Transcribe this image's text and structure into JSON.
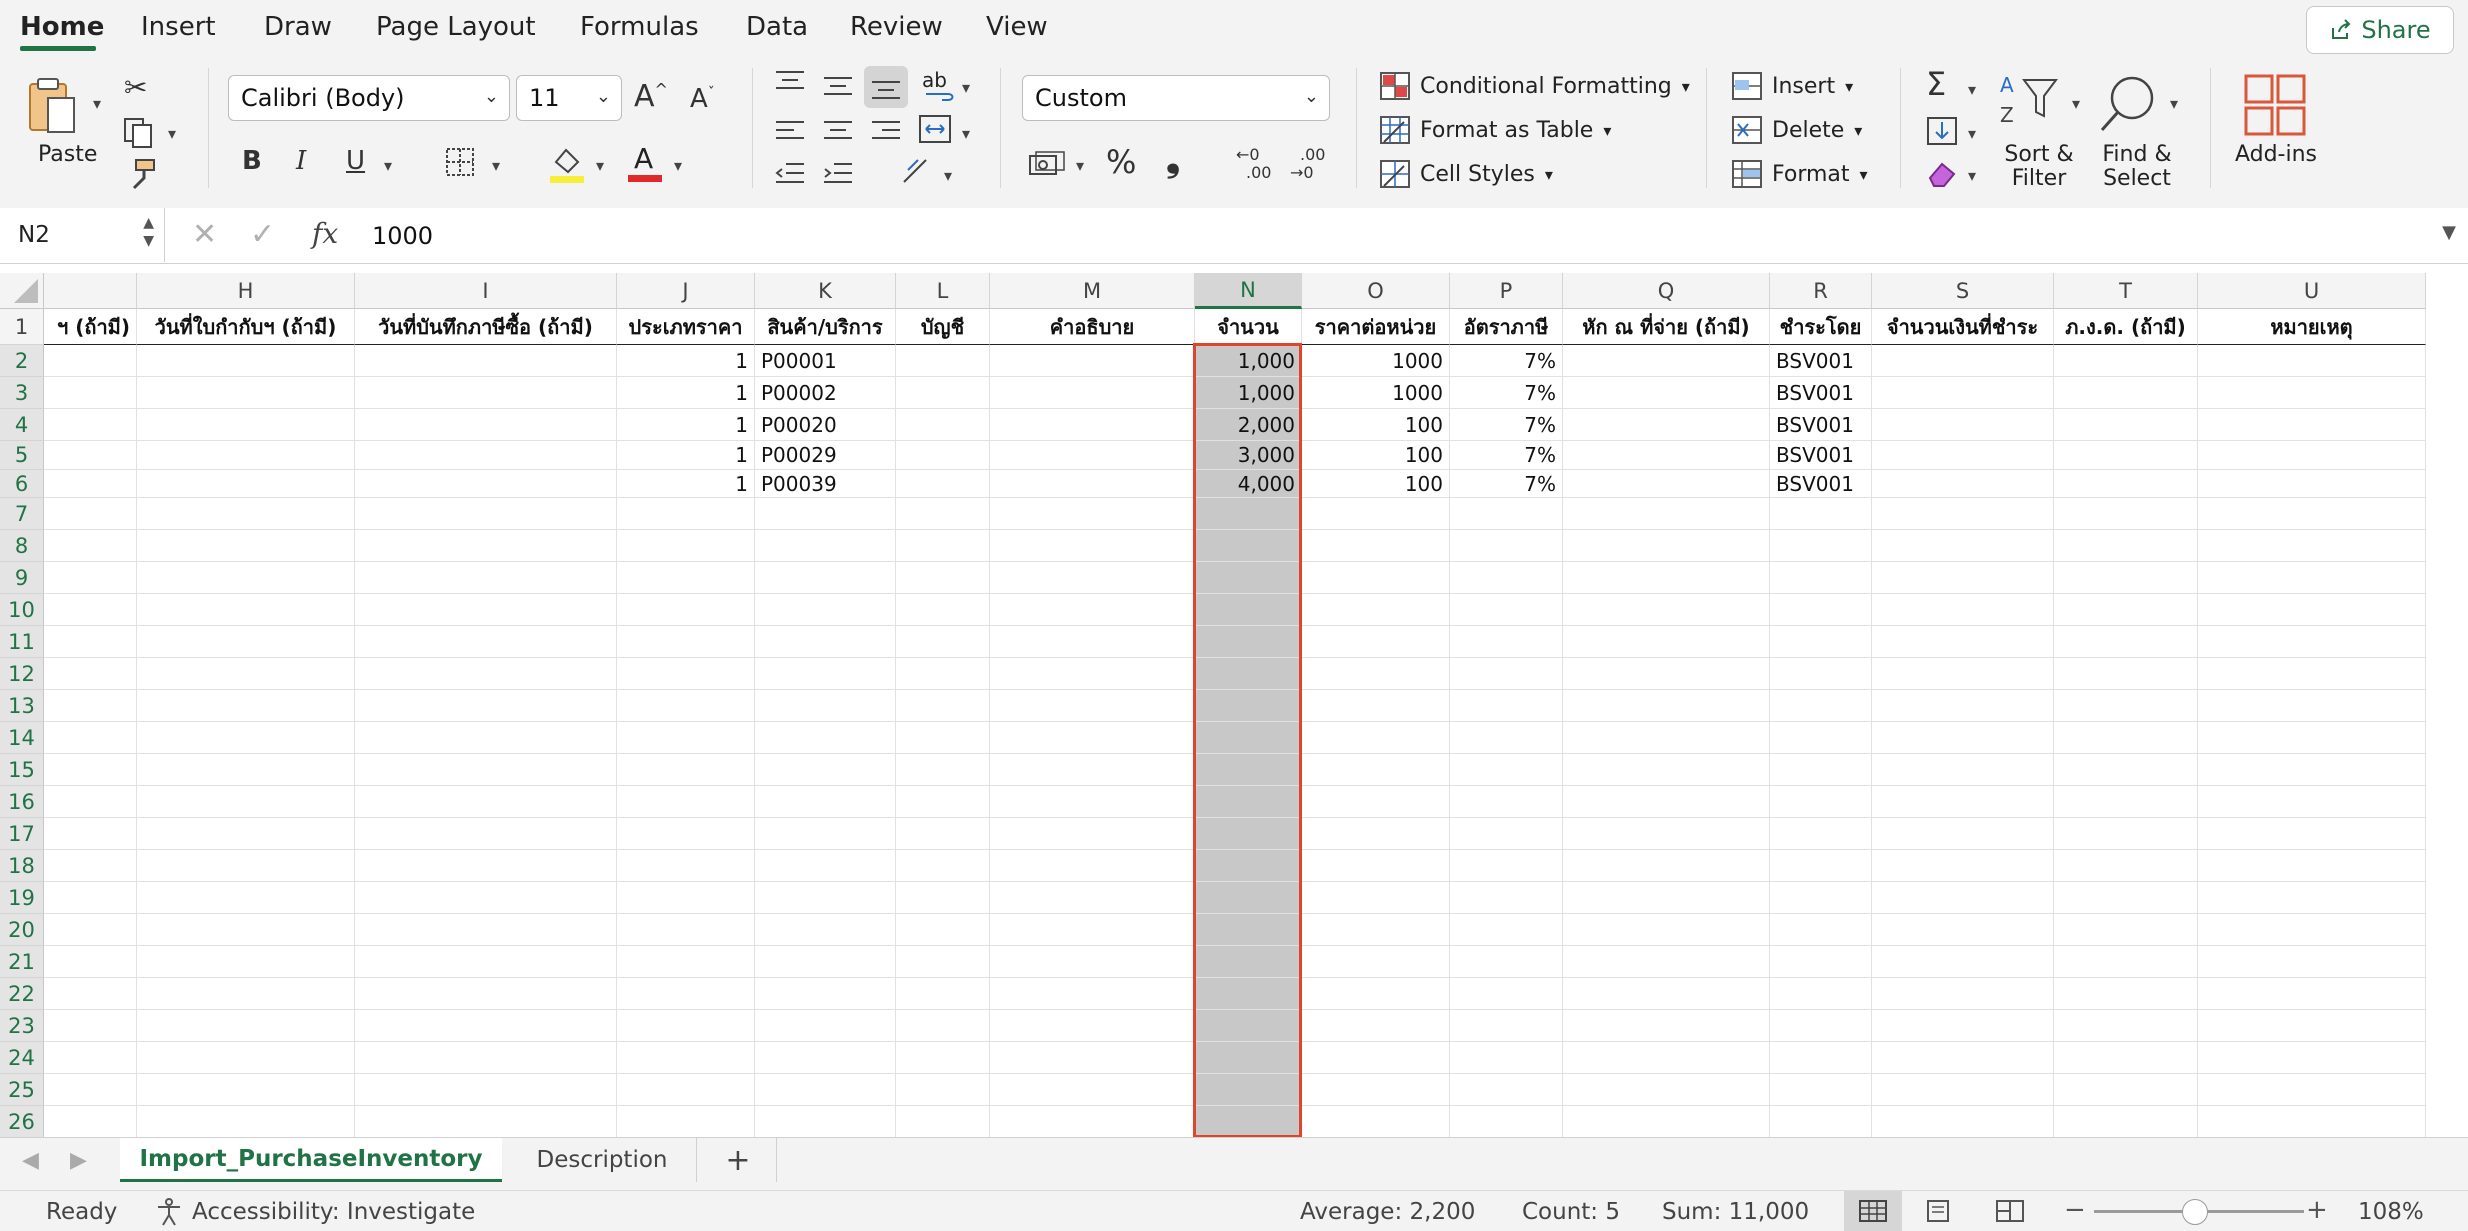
{
  "ribbon": {
    "tabs": [
      "Home",
      "Insert",
      "Draw",
      "Page Layout",
      "Formulas",
      "Data",
      "Review",
      "View"
    ],
    "share_label": "Share",
    "paste_label": "Paste",
    "font_name": "Calibri (Body)",
    "font_size": "11",
    "number_format": "Custom",
    "conditional_formatting": "Conditional Formatting",
    "format_as_table": "Format as Table",
    "cell_styles": "Cell Styles",
    "insert": "Insert",
    "delete": "Delete",
    "format": "Format",
    "sort_filter_1": "Sort &",
    "sort_filter_2": "Filter",
    "find_select_1": "Find &",
    "find_select_2": "Select",
    "addins": "Add-ins",
    "bold": "B",
    "italic": "I",
    "underline": "U",
    "font_color_letter": "A",
    "increase_font": "A",
    "decrease_font": "A",
    "percent": "%",
    "comma": "❟",
    "inc_decimal_1": "←0",
    "inc_decimal_2": ".00",
    "dec_decimal_1": ".00",
    "dec_decimal_2": "→0",
    "wrap_text": "ab"
  },
  "formula_bar": {
    "name_box": "N2",
    "fx_label": "fx",
    "value": "1000"
  },
  "grid": {
    "columns": [
      {
        "letter": "",
        "header": "ฯ (ถ้ามี)"
      },
      {
        "letter": "H",
        "header": "วันที่ใบกำกับฯ (ถ้ามี)"
      },
      {
        "letter": "I",
        "header": "วันที่บันทึกภาษีซื้อ (ถ้ามี)"
      },
      {
        "letter": "J",
        "header": "ประเภทราคา"
      },
      {
        "letter": "K",
        "header": "สินค้า/บริการ"
      },
      {
        "letter": "L",
        "header": "บัญชี"
      },
      {
        "letter": "M",
        "header": "คำอธิบาย"
      },
      {
        "letter": "N",
        "header": "จำนวน"
      },
      {
        "letter": "O",
        "header": "ราคาต่อหน่วย"
      },
      {
        "letter": "P",
        "header": "อัตราภาษี"
      },
      {
        "letter": "Q",
        "header": "หัก ณ ที่จ่าย (ถ้ามี)"
      },
      {
        "letter": "R",
        "header": "ชำระโดย"
      },
      {
        "letter": "S",
        "header": "จำนวนเงินที่ชำระ"
      },
      {
        "letter": "T",
        "header": "ภ.ง.ด. (ถ้ามี)"
      },
      {
        "letter": "U",
        "header": "หมายเหตุ"
      }
    ],
    "rows": [
      {
        "num": "2",
        "J": "1",
        "K": "P00001",
        "N": "1,000",
        "O": "1000",
        "P": "7%",
        "R": "BSV001"
      },
      {
        "num": "3",
        "J": "1",
        "K": "P00002",
        "N": "1,000",
        "O": "1000",
        "P": "7%",
        "R": "BSV001"
      },
      {
        "num": "4",
        "J": "1",
        "K": "P00020",
        "N": "2,000",
        "O": "100",
        "P": "7%",
        "R": "BSV001"
      },
      {
        "num": "5",
        "J": "1",
        "K": "P00029",
        "N": "3,000",
        "O": "100",
        "P": "7%",
        "R": "BSV001"
      },
      {
        "num": "6",
        "J": "1",
        "K": "P00039",
        "N": "4,000",
        "O": "100",
        "P": "7%",
        "R": "BSV001"
      }
    ],
    "row_numbers": [
      "1",
      "2",
      "3",
      "4",
      "5",
      "6",
      "7",
      "8",
      "9",
      "10",
      "11",
      "12",
      "13",
      "14",
      "15",
      "16",
      "17",
      "18",
      "19",
      "20",
      "21",
      "22",
      "23",
      "24",
      "25",
      "26"
    ],
    "selected_column": "N",
    "accent_color": "#217346",
    "selection_border_color": "#e0452b",
    "selection_fill_color": "#c8c8c8"
  },
  "sheet_tabs": {
    "active": "Import_PurchaseInventory",
    "other": "Description",
    "add": "+"
  },
  "status_bar": {
    "ready": "Ready",
    "accessibility": "Accessibility: Investigate",
    "average": "Average:  2,200",
    "count": "Count: 5",
    "sum": "Sum:  11,000",
    "zoom": "108%"
  }
}
